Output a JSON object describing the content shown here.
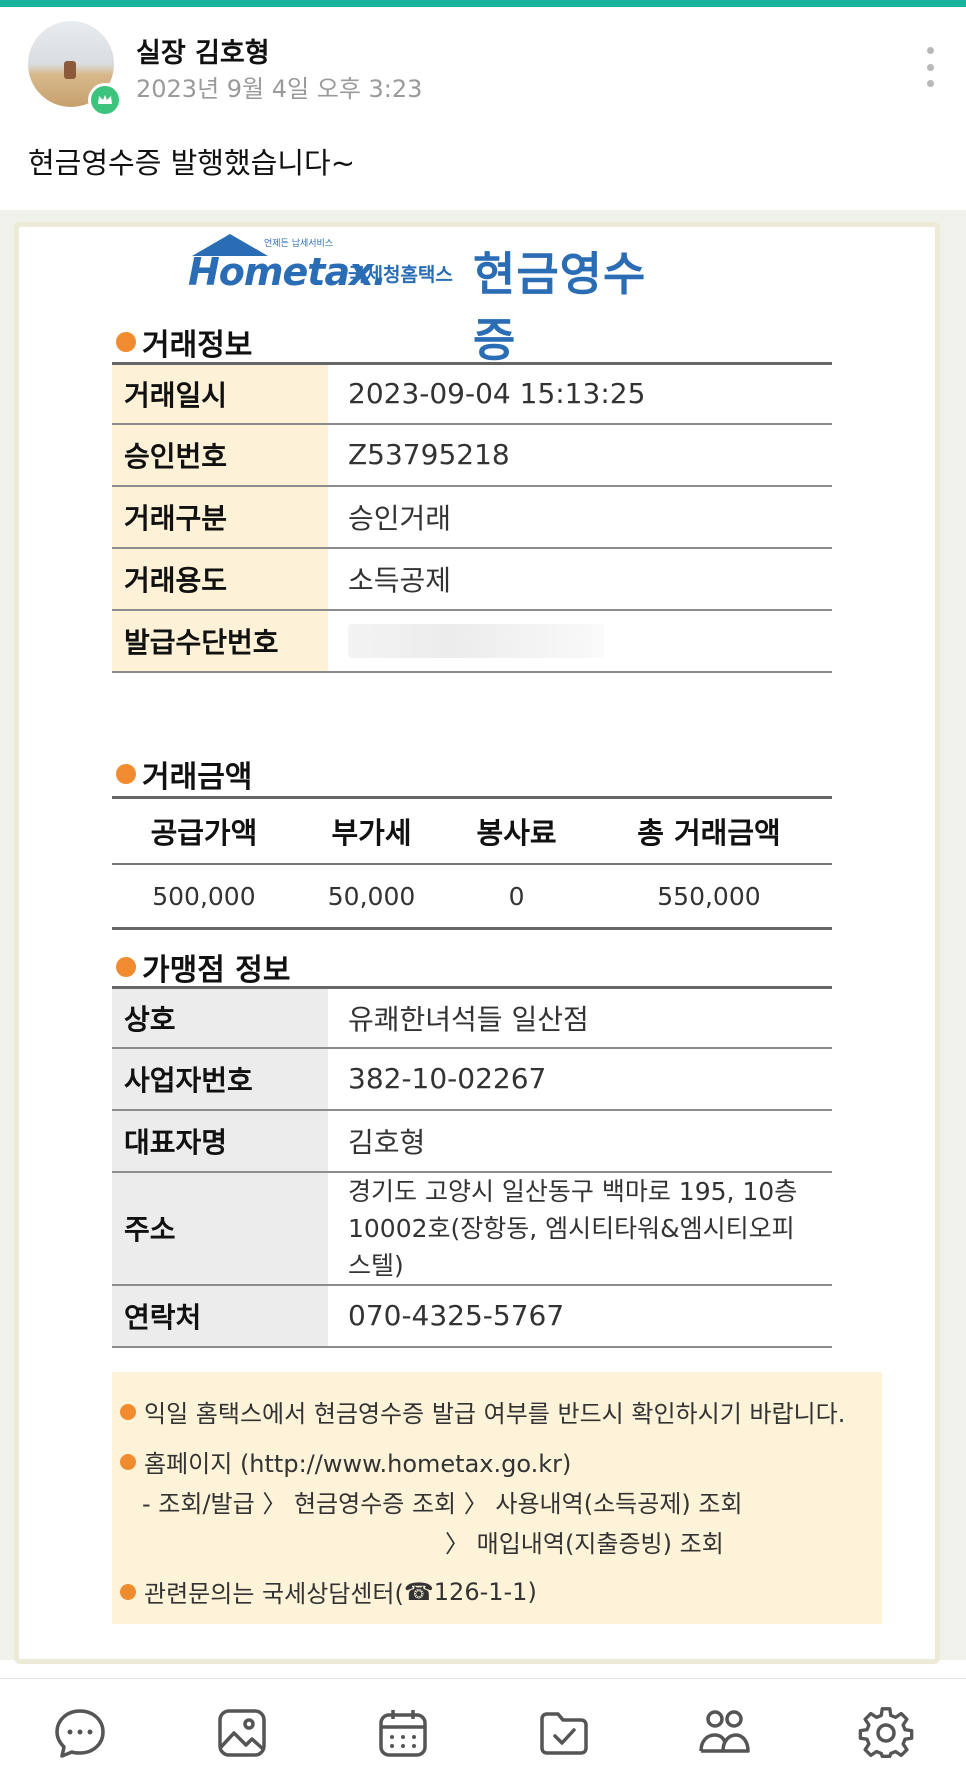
{
  "post": {
    "author": "실장 김호형",
    "timestamp": "2023년 9월 4일 오후 3:23",
    "text": "현금영수증 발행했습니다~"
  },
  "receipt": {
    "logo_text": "Hometax.",
    "logo_sub": "국세청홈택스",
    "logo_tag": "언제든 납세서비스",
    "title": "현금영수증",
    "section_transaction": "거래정보",
    "transaction_rows": [
      {
        "key": "거래일시",
        "value": "2023-09-04 15:13:25"
      },
      {
        "key": "승인번호",
        "value": "Z53795218"
      },
      {
        "key": "거래구분",
        "value": "승인거래"
      },
      {
        "key": "거래용도",
        "value": "소득공제"
      },
      {
        "key": "발급수단번호",
        "value": ""
      }
    ],
    "section_amount": "거래금액",
    "amount_headers": [
      "공급가액",
      "부가세",
      "봉사료",
      "총 거래금액"
    ],
    "amount_values": [
      "500,000",
      "50,000",
      "0",
      "550,000"
    ],
    "section_merchant": "가맹점 정보",
    "merchant_rows": [
      {
        "key": "상호",
        "value": "유쾌한녀석들 일산점"
      },
      {
        "key": "사업자번호",
        "value": "382-10-02267"
      },
      {
        "key": "대표자명",
        "value": "김호형"
      },
      {
        "key": "주소",
        "value_lines": [
          "경기도 고양시 일산동구 백마로 195, 10층",
          "10002호(장항동, 엠시티타워&엠시티오피",
          "스텔)"
        ]
      },
      {
        "key": "연락처",
        "value": "070-4325-5767"
      }
    ],
    "notice": {
      "line1": "익일 홈택스에서 현금영수증 발급 여부를 반드시 확인하시기 바랍니다.",
      "line2": "홈페이지 (http://www.hometax.go.kr)",
      "line3": "- 조회/발급 〉 현금영수증 조회 〉 사용내역(소득공제) 조회",
      "line4": "〉 매입내역(지출증빙) 조회",
      "line5_prefix": "관련문의는 국세상담센터(",
      "line5_phone_icon": "☎",
      "line5_suffix": "126-1-1)"
    }
  },
  "bottom_nav": [
    "chat-icon",
    "image-icon",
    "calendar-icon",
    "folder-check-icon",
    "members-icon",
    "settings-icon"
  ],
  "colors": {
    "accent_bar": "#19b39c",
    "hometax_blue": "#2a6db5",
    "bullet_orange": "#f08c2f",
    "crown_green": "#3cc47c"
  }
}
